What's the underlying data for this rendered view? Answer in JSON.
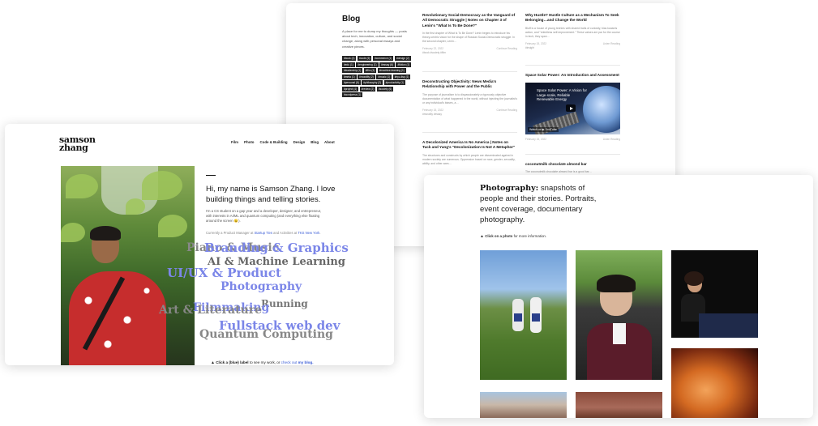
{
  "blog": {
    "title": "Blog",
    "description": "A place for me to dump my thoughts — posts about tech, innovation, culture, and social change, along with personal essays and creative pieces.",
    "tags": [
      "#book (2)",
      "#code (6)",
      "#commerce (1)",
      "#design (2)",
      "#edu (1)",
      "#engineering (1)",
      "#essay (6)",
      "#fiction (1)",
      "#leadership (1)",
      "#film (3)",
      "#machine-learning (1)",
      "#meta (1)",
      "#morality (2)",
      "#music (1)",
      "#nyu-tisp (1)",
      "#personal (6)",
      "#philosophy (2)",
      "#productivity (1)",
      "#project (4)",
      "#review (2)",
      "#society (6)",
      "#wordpress (1)"
    ],
    "posts": [
      {
        "title": "Revolutionary Social-Democracy as the Vanguard of All Democratic Struggle | Notes on Chapter 3 of Lenin's \"What Is To Be Done?\"",
        "excerpt": "In the first chapter of What Is To Be Done? Lenin begins to introduce his theory-centric vision for the shape of Russian Social-Democratic struggle. In the second chapter, Lenin…",
        "date": "February 22, 2022",
        "tags": "#book #society #film",
        "more": "Continue Reading"
      },
      {
        "title": "Deconstructing Objectivity: News Media's Relationship with Power and the Public",
        "excerpt": "The purpose of journalism is to dispassionately a rigorously objective documentation of what happened in the world, without injecting the journalist's or any individual's biases, a…",
        "date": "February 15, 2022",
        "tags": "#morality #essay",
        "more": "Continue Reading"
      },
      {
        "title": "A Decolonized America Is No America | Notes on Tuck and Yang's \"Decolonization Is Not A Metaphor\"",
        "excerpt": "The structures and constructs by which people are disseminated against in modern society are numerous. Oppression based on race, gender, sexuality, ability, and other axes…",
        "date": "",
        "tags": "",
        "more": ""
      },
      {
        "title": "Why Hustle? Hustle Culture as a Mechanism To Seek Belonging…and Change the World",
        "excerpt": "Bluff is a house of young techies with shared traits of curiosity, bias towards action, and \"relentless self-improvement.\" These values are par for the course in tech; they span…",
        "date": "February 15, 2022",
        "tags": "#insight",
        "more": "Listen Reading"
      },
      {
        "title": "Space Solar Power: An Introduction and Assessment",
        "excerpt": "",
        "date": "February 15, 2022",
        "tags": "",
        "more": "Listen Reading"
      },
      {
        "title": "coconutmilk chocolate almond bar",
        "excerpt": "The coconutmilk chocolate almond bar is a good bar…",
        "date": "",
        "tags": "",
        "more": ""
      }
    ],
    "video": {
      "title": "Space Solar Power: A Vision for Large-scale, Reliable Renewable Energy",
      "watch": "Watch on ▶ YouTube"
    }
  },
  "home": {
    "logo_line1": "samson",
    "logo_line2": "zhang",
    "nav": [
      "Film",
      "Photo",
      "Code & Building",
      "Design",
      "Blog",
      "About"
    ],
    "intro": "Hi, my name is Samson Zhang. I love building things and telling stories.",
    "bio": "I'm a CS student on a gap year and a developer, designer, and entrepreneur, with interests in AI/ML and quantum computing (and everything else floating around the screen 😉).",
    "currently_prefix": "Currently a Product Manager at ",
    "currently_link1": "Startup Ties",
    "currently_mid": " and Activities at ",
    "currently_link2": "TKS New York",
    "currently_suffix": ".",
    "skills": [
      {
        "label": "Piano & Music",
        "color": "#888888"
      },
      {
        "label": "Branding & Graphics",
        "color": "#7b86e8"
      },
      {
        "label": "AI & Machine Learning",
        "color": "#666666"
      },
      {
        "label": "UI/UX & Product",
        "color": "#7b86e8"
      },
      {
        "label": "Photography",
        "color": "#7b86e8"
      },
      {
        "label": "Running",
        "color": "#777777"
      },
      {
        "label": "Filmmaking",
        "color": "#7b86e8"
      },
      {
        "label": "Art & Literature",
        "color": "#888888"
      },
      {
        "label": "Fullstack web dev",
        "color": "#7b86e8"
      },
      {
        "label": "Quantum Computing",
        "color": "#888888"
      }
    ],
    "cta_prefix": "Click a (blue) label",
    "cta_mid": " to see my work, or ",
    "cta_plain": "check out ",
    "cta_link": "my blog."
  },
  "photography": {
    "heading_bold": "Photography:",
    "heading_rest": " snapshots of people and their stories. Portraits, event coverage, documentary photography.",
    "hint_bold": "Click on a photo",
    "hint_rest": " for more information."
  },
  "colors": {
    "accent": "#3a5cd6",
    "skill_blue": "#7b86e8"
  }
}
